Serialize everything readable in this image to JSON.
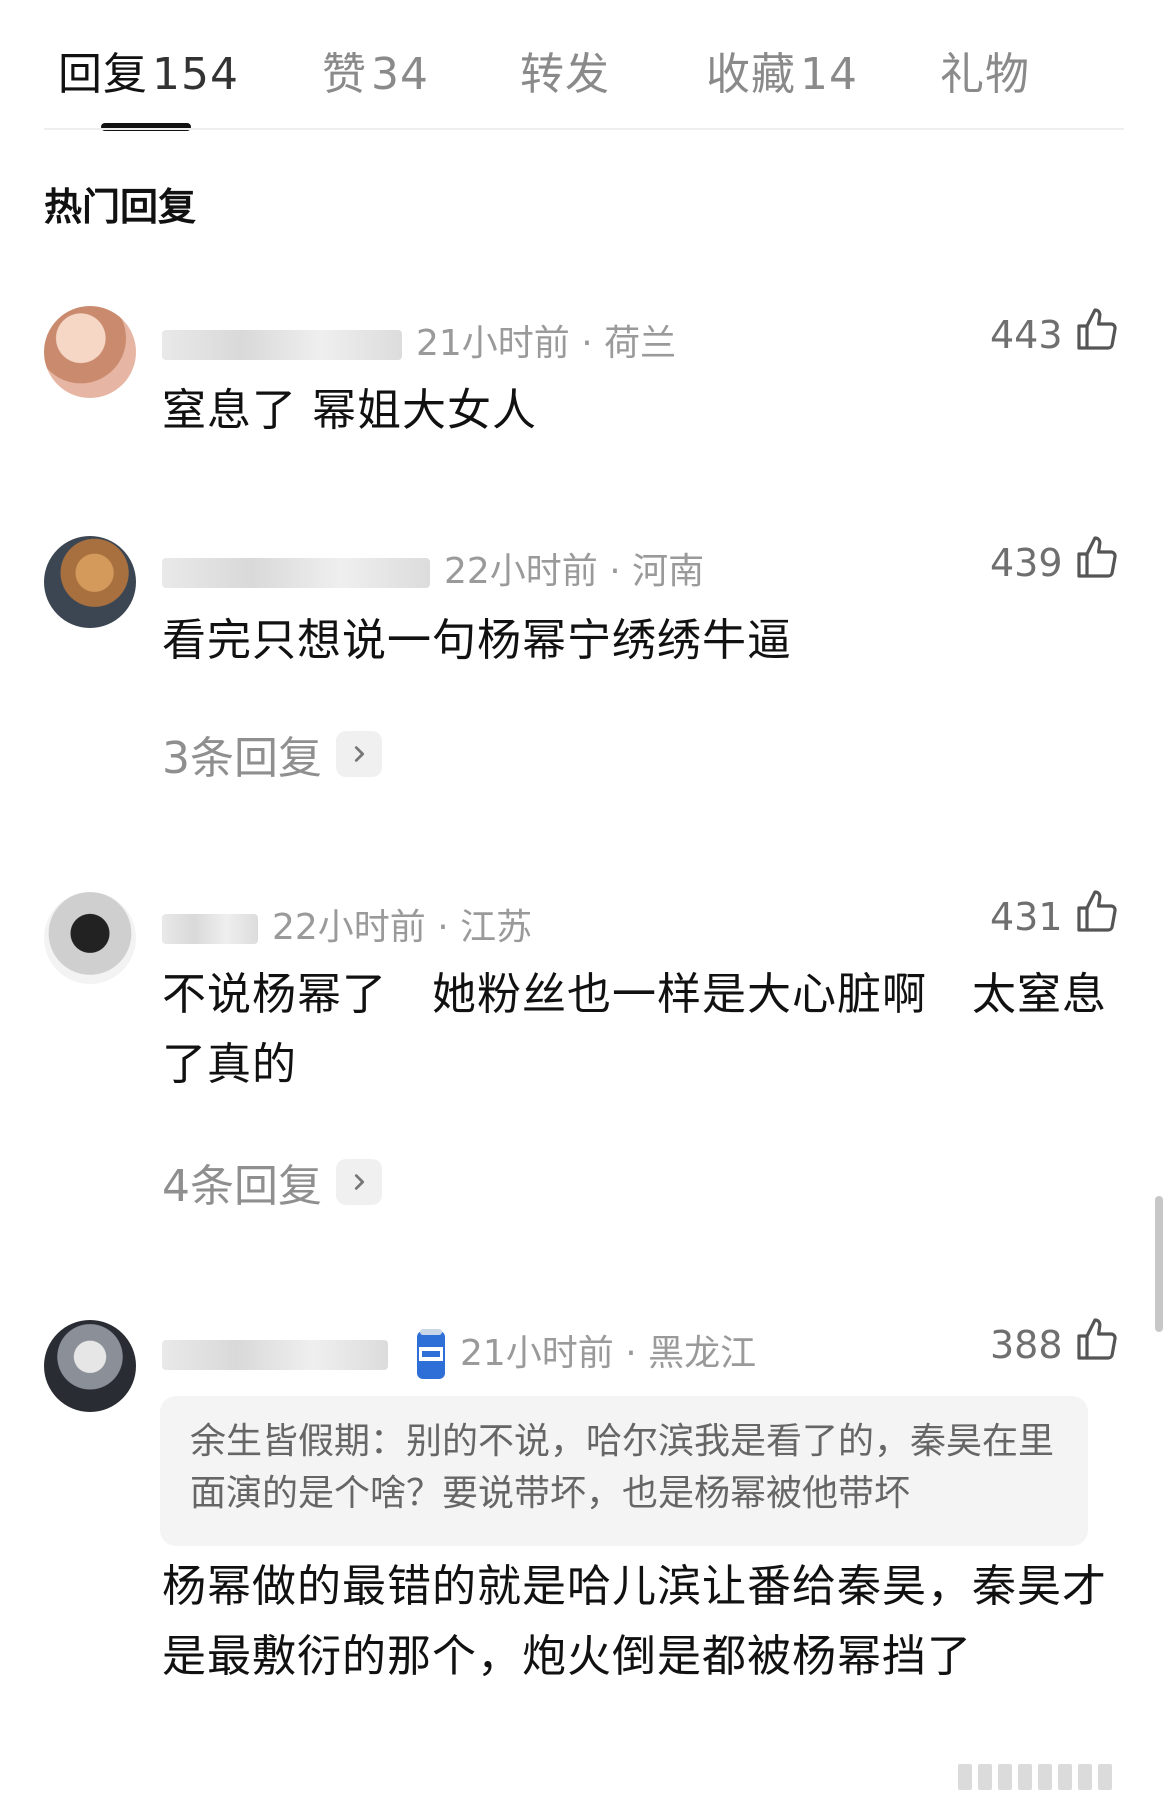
{
  "tabs": [
    {
      "label": "回复",
      "count": "154"
    },
    {
      "label": "赞",
      "count": "34"
    },
    {
      "label": "转发",
      "count": ""
    },
    {
      "label": "收藏",
      "count": "14"
    },
    {
      "label": "礼物",
      "count": ""
    }
  ],
  "section_title": "热门回复",
  "comments": [
    {
      "time": "21小时前",
      "location": "荷兰",
      "likes": "443",
      "text": "窒息了 幂姐大女人"
    },
    {
      "time": "22小时前",
      "location": "河南",
      "likes": "439",
      "text": "看完只想说一句杨幂宁绣绣牛逼",
      "replies": "3条回复"
    },
    {
      "time": "22小时前",
      "location": "江苏",
      "likes": "431",
      "text": "不说杨幂了　她粉丝也一样是大心脏啊　太窒息了真的",
      "replies": "4条回复"
    },
    {
      "name": "余生皆假期",
      "time": "21小时前",
      "location": "黑龙江",
      "likes": "388",
      "quote": "余生皆假期：别的不说，哈尔滨我是看了的，秦昊在里面演的是个啥？要说带坏，也是杨幂被他带坏",
      "text": "杨幂做的最错的就是哈儿滨让番给秦昊，秦昊才是最敷衍的那个，炮火倒是都被杨幂挡了"
    }
  ],
  "icons": {
    "like": "thumbs-up-icon",
    "chevron": "chevron-right-icon",
    "badge": "beer-can-badge-icon"
  }
}
